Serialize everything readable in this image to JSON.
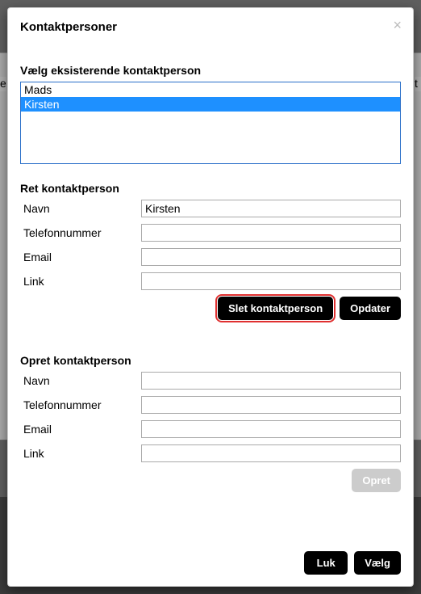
{
  "modal": {
    "title": "Kontaktpersoner",
    "close": "×"
  },
  "select_section": {
    "label": "Vælg eksisterende kontaktperson",
    "options": [
      "Mads",
      "Kirsten"
    ],
    "selected_index": 1
  },
  "edit_section": {
    "label": "Ret kontaktperson",
    "fields": {
      "name_label": "Navn",
      "name_value": "Kirsten",
      "phone_label": "Telefonnummer",
      "phone_value": "",
      "email_label": "Email",
      "email_value": "",
      "link_label": "Link",
      "link_value": ""
    },
    "delete_btn": "Slet kontaktperson",
    "update_btn": "Opdater"
  },
  "create_section": {
    "label": "Opret kontaktperson",
    "fields": {
      "name_label": "Navn",
      "name_value": "",
      "phone_label": "Telefonnummer",
      "phone_value": "",
      "email_label": "Email",
      "email_value": "",
      "link_label": "Link",
      "link_value": ""
    },
    "create_btn": "Opret"
  },
  "footer": {
    "close_btn": "Luk",
    "select_btn": "Vælg"
  }
}
